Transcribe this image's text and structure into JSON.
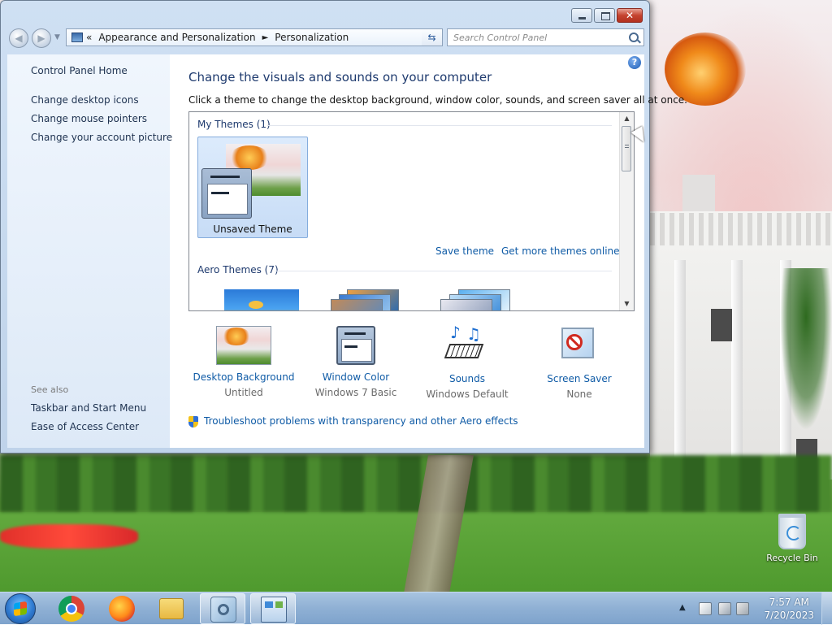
{
  "window": {
    "title": "Personalization",
    "caption_buttons": {
      "minimize": "minimize-icon",
      "maximize": "maximize-icon",
      "close": "close-icon"
    }
  },
  "nav": {
    "address": {
      "crumb_prefix": "«",
      "crumbs": [
        "Appearance and Personalization",
        "Personalization"
      ],
      "separator": "►"
    },
    "search_placeholder": "Search Control Panel"
  },
  "sidebar": {
    "home": "Control Panel Home",
    "links": [
      "Change desktop icons",
      "Change mouse pointers",
      "Change your account picture"
    ],
    "see_also_label": "See also",
    "see_also": [
      "Taskbar and Start Menu",
      "Ease of Access Center"
    ]
  },
  "main": {
    "title": "Change the visuals and sounds on your computer",
    "subtitle": "Click a theme to change the desktop background, window color, sounds, and screen saver all at once.",
    "my_themes_header": "My Themes (1)",
    "selected_theme": "Unsaved Theme",
    "save_theme": "Save theme",
    "get_more": "Get more themes online",
    "aero_header": "Aero Themes (7)"
  },
  "settings": [
    {
      "name": "Desktop Background",
      "value": "Untitled",
      "icon": "desktop-background-icon"
    },
    {
      "name": "Window Color",
      "value": "Windows 7 Basic",
      "icon": "window-color-icon"
    },
    {
      "name": "Sounds",
      "value": "Windows Default",
      "icon": "sounds-icon"
    },
    {
      "name": "Screen Saver",
      "value": "None",
      "icon": "screen-saver-icon"
    }
  ],
  "troubleshoot": "Troubleshoot problems with transparency and other Aero effects",
  "desktop": {
    "recycle_bin": "Recycle Bin"
  },
  "taskbar": {
    "apps": [
      "chrome-icon",
      "firefox-icon",
      "file-explorer-icon",
      "media-icon",
      "control-panel-icon"
    ],
    "time": "7:57 AM",
    "date": "7/20/2023"
  },
  "colors": {
    "link": "#0f5ba6",
    "title": "#1e3a6e",
    "taskbar": "#8fb0d4"
  }
}
